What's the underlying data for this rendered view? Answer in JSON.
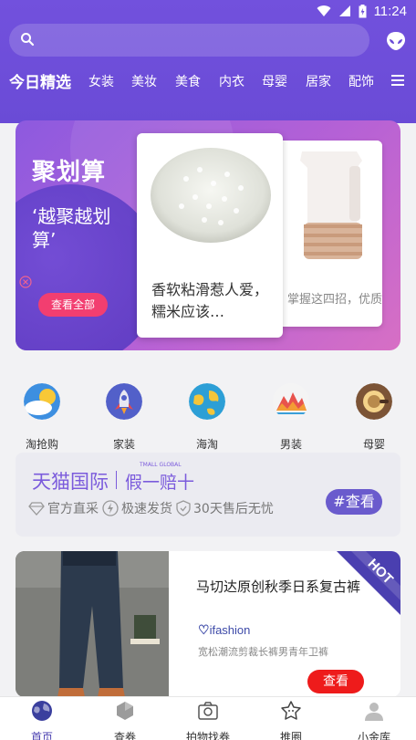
{
  "status_bar": {
    "time": "11:24"
  },
  "categories": [
    {
      "label": "今日精选",
      "active": true
    },
    {
      "label": "女装"
    },
    {
      "label": "美妆"
    },
    {
      "label": "美食"
    },
    {
      "label": "内衣"
    },
    {
      "label": "母婴"
    },
    {
      "label": "居家"
    },
    {
      "label": "配饰"
    }
  ],
  "banner": {
    "logo": "聚划算",
    "slogan": "‘越聚越划算’",
    "see_all": "查看全部",
    "front_card_text": "香软粘滑惹人爱，糯米应该…",
    "back_card_text": "掌握这四招，优质破壁机随你选"
  },
  "quick_links": [
    {
      "label": "淘抢购",
      "icon": "cloud-sun-icon"
    },
    {
      "label": "家装",
      "icon": "rocket-icon"
    },
    {
      "label": "海淘",
      "icon": "globe-icon"
    },
    {
      "label": "男装",
      "icon": "mountains-icon"
    },
    {
      "label": "母婴",
      "icon": "pot-icon"
    }
  ],
  "tmall": {
    "title": "天猫国际",
    "tag": "TMALL GLOBAL",
    "subtitle": "假一赔十",
    "features": [
      "官方直采",
      "极速发货",
      "30天售后无忧"
    ],
    "button": "#查看"
  },
  "product": {
    "title": "马切达原创秋季日系复古裤",
    "brand": "ifashion",
    "desc": "宽松潮流剪裁长裤男青年卫裤",
    "badge": "HOT",
    "button": "查看"
  },
  "bottom_nav": [
    {
      "label": "首页",
      "active": true
    },
    {
      "label": "查券"
    },
    {
      "label": "拍物找券"
    },
    {
      "label": "推圈"
    },
    {
      "label": "小金库"
    }
  ],
  "colors": {
    "header": "#7251dd",
    "accent_red": "#f23e70",
    "tmall_purple": "#7b5bdc"
  }
}
